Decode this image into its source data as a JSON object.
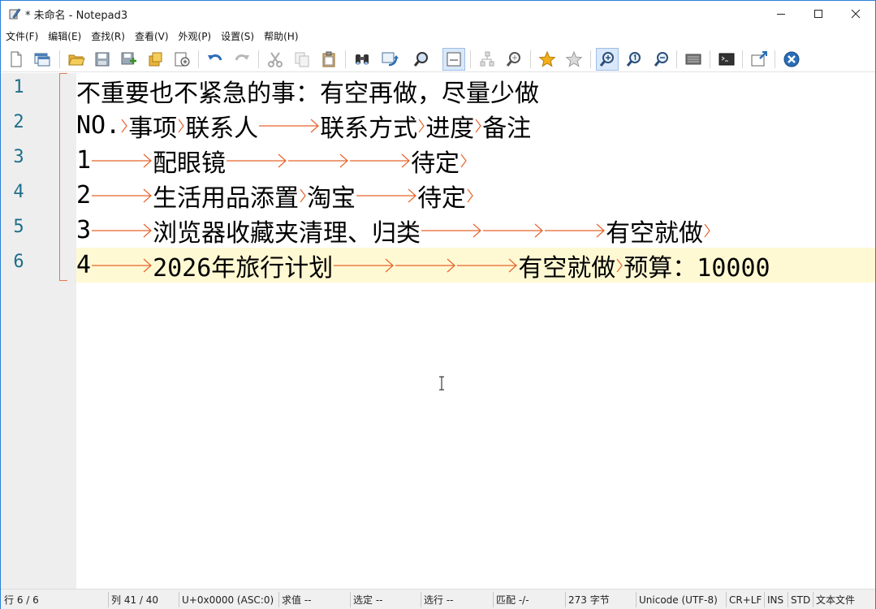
{
  "window": {
    "title": "* 未命名 - Notepad3",
    "app_icon": "notepad-pen-icon",
    "controls": [
      "minimize-icon",
      "maximize-icon",
      "close-icon"
    ]
  },
  "menu": [
    "文件(F)",
    "编辑(E)",
    "查找(R)",
    "查看(V)",
    "外观(P)",
    "设置(S)",
    "帮助(H)"
  ],
  "toolbar": {
    "buttons": [
      "new-file-icon",
      "new-window-icon",
      "open-folder-icon",
      "save-icon",
      "save-as-icon",
      "save-copy-icon",
      "open-with-icon",
      "undo-icon",
      "redo-icon",
      "cut-icon",
      "copy-icon",
      "paste-icon",
      "find-icon",
      "replace-icon",
      "find-next-icon",
      "word-wrap-icon",
      "tree-icon",
      "zoom-search-icon",
      "favorites-icon",
      "add-favorite-icon",
      "zoom-in-icon",
      "reset-zoom-icon",
      "zoom-out-icon",
      "encoding-icon",
      "terminal-icon",
      "pin-icon",
      "exit-icon"
    ]
  },
  "editor": {
    "line_numbers": [
      "1",
      "2",
      "3",
      "4",
      "5",
      "6"
    ],
    "current_line": 6,
    "lines": [
      {
        "segments": [
          "不重要也不紧急的事：有空再做，尽量少做"
        ],
        "tabs": []
      },
      {
        "segments": [
          "NO.",
          "事项",
          "联系人",
          "联系方式",
          "进度",
          "备注"
        ],
        "tabs": [
          "s",
          "s",
          "l",
          "s",
          "s"
        ]
      },
      {
        "segments": [
          "1",
          "配眼镜",
          "",
          "",
          "待定",
          ""
        ],
        "tabs": [
          "l",
          "l",
          "l",
          "l",
          "s"
        ]
      },
      {
        "segments": [
          "2",
          "生活用品添置",
          "淘宝",
          "待定",
          ""
        ],
        "tabs": [
          "l",
          "s",
          "l",
          "s"
        ]
      },
      {
        "segments": [
          "3",
          "浏览器收藏夹清理、归类",
          "",
          "",
          "有空就做",
          ""
        ],
        "tabs": [
          "l",
          "l",
          "l",
          "l",
          "s"
        ]
      },
      {
        "segments": [
          "4",
          "2026年旅行计划",
          "",
          "",
          "有空就做",
          "预算：10000"
        ],
        "tabs": [
          "l",
          "l",
          "l",
          "l",
          "s"
        ]
      }
    ],
    "colors": {
      "tab_arrow": "#e8632b",
      "line_number": "#1d6f8a",
      "current_line_bg": "#fff9d3"
    }
  },
  "status": {
    "line": "行 6 / 6",
    "column": "列 41 / 40",
    "char_code": "U+0x0000 (ASC:0)",
    "sum": "求值 --",
    "selection": "选定 --",
    "selected_lines": "选行 --",
    "match": "匹配 -/-",
    "size": "273 字节",
    "encoding": "Unicode (UTF-8)",
    "eol": "CR+LF",
    "ins": "INS",
    "std": "STD",
    "file_type": "文本文件"
  }
}
